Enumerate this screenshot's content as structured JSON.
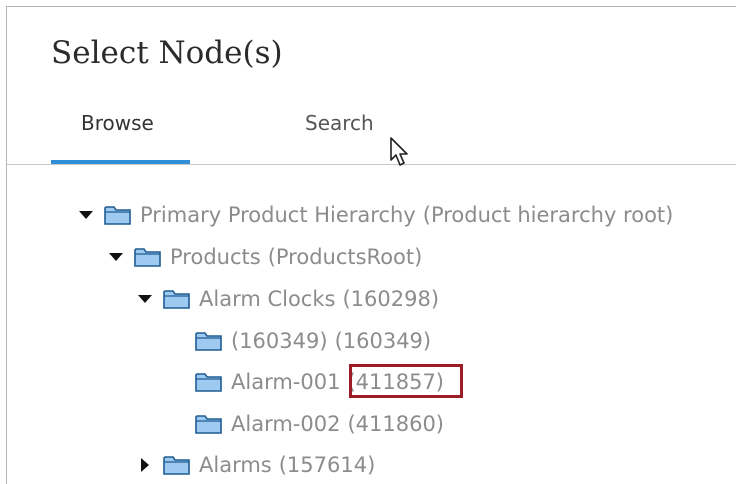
{
  "dialog": {
    "title": "Select Node(s)"
  },
  "tabs": [
    {
      "label": "Browse",
      "active": true
    },
    {
      "label": "Search",
      "active": false
    }
  ],
  "colors": {
    "accent": "#2f8fd6",
    "highlight_border": "#9b1c25",
    "node_text": "#8c8c8c",
    "folder_fill": "#9ec9f0",
    "folder_stroke": "#1f5d93"
  },
  "tree": [
    {
      "name": "Primary Product Hierarchy",
      "code": "(Product hierarchy root)",
      "level": 0,
      "toggle": "expanded",
      "icon": "folder-icon"
    },
    {
      "name": "Products",
      "code": "(ProductsRoot)",
      "level": 1,
      "toggle": "expanded",
      "icon": "folder-icon"
    },
    {
      "name": "Alarm Clocks",
      "code": "(160298)",
      "level": 2,
      "toggle": "expanded",
      "icon": "folder-icon"
    },
    {
      "name": "(160349)",
      "code": "(160349)",
      "level": 3,
      "toggle": "none",
      "icon": "folder-icon"
    },
    {
      "name": "Alarm-001",
      "code": "(411857)",
      "level": 3,
      "toggle": "none",
      "icon": "folder-icon",
      "highlighted": true
    },
    {
      "name": "Alarm-002",
      "code": "(411860)",
      "level": 3,
      "toggle": "none",
      "icon": "folder-icon"
    },
    {
      "name": "Alarms",
      "code": "(157614)",
      "level": 2,
      "toggle": "collapsed",
      "icon": "folder-icon"
    }
  ]
}
